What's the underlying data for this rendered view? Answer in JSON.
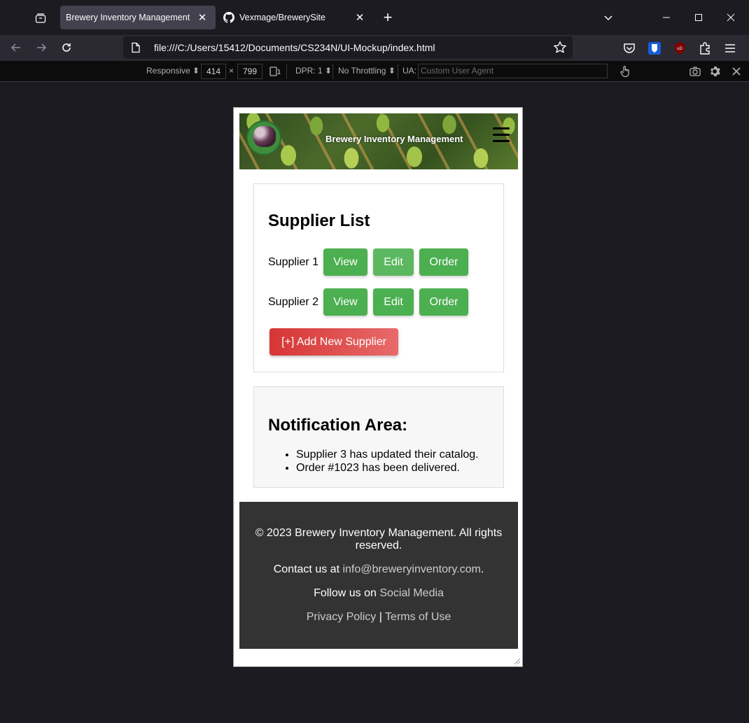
{
  "browser": {
    "tabs": [
      {
        "title": "Brewery Inventory Management",
        "active": true
      },
      {
        "title": "Vexmage/BrewerySite",
        "active": false
      }
    ],
    "url": "file:///C:/Users/15412/Documents/CS234N/UI-Mockup/index.html"
  },
  "rdm_toolbar": {
    "device": "Responsive",
    "width": "414",
    "times": "×",
    "height": "799",
    "dpr": "DPR: 1",
    "throttling": "No Throttling",
    "ua_label": "UA:",
    "ua_placeholder": "Custom User Agent"
  },
  "page": {
    "header_title": "Brewery Inventory Management",
    "supplier_list": {
      "heading": "Supplier List",
      "suppliers": [
        {
          "name": "Supplier 1"
        },
        {
          "name": "Supplier 2"
        }
      ],
      "view_label": "View",
      "edit_label": "Edit",
      "order_label": "Order",
      "add_label": "[+] Add New Supplier"
    },
    "notifications": {
      "heading": "Notification Area:",
      "items": [
        "Supplier 3 has updated their catalog.",
        "Order #1023 has been delivered."
      ]
    },
    "footer": {
      "copyright": "© 2023 Brewery Inventory Management. All rights reserved.",
      "contact_prefix": "Contact us at ",
      "contact_email": "info@breweryinventory.com",
      "contact_suffix": ".",
      "follow_prefix": "Follow us on ",
      "follow_link": "Social Media",
      "privacy": "Privacy Policy",
      "link_sep": " | ",
      "terms": "Terms of Use"
    }
  },
  "colors": {
    "button_green": "#4caf50",
    "add_red": "#d63535",
    "footer_bg": "#333333",
    "browser_bg": "#1c1b22"
  }
}
